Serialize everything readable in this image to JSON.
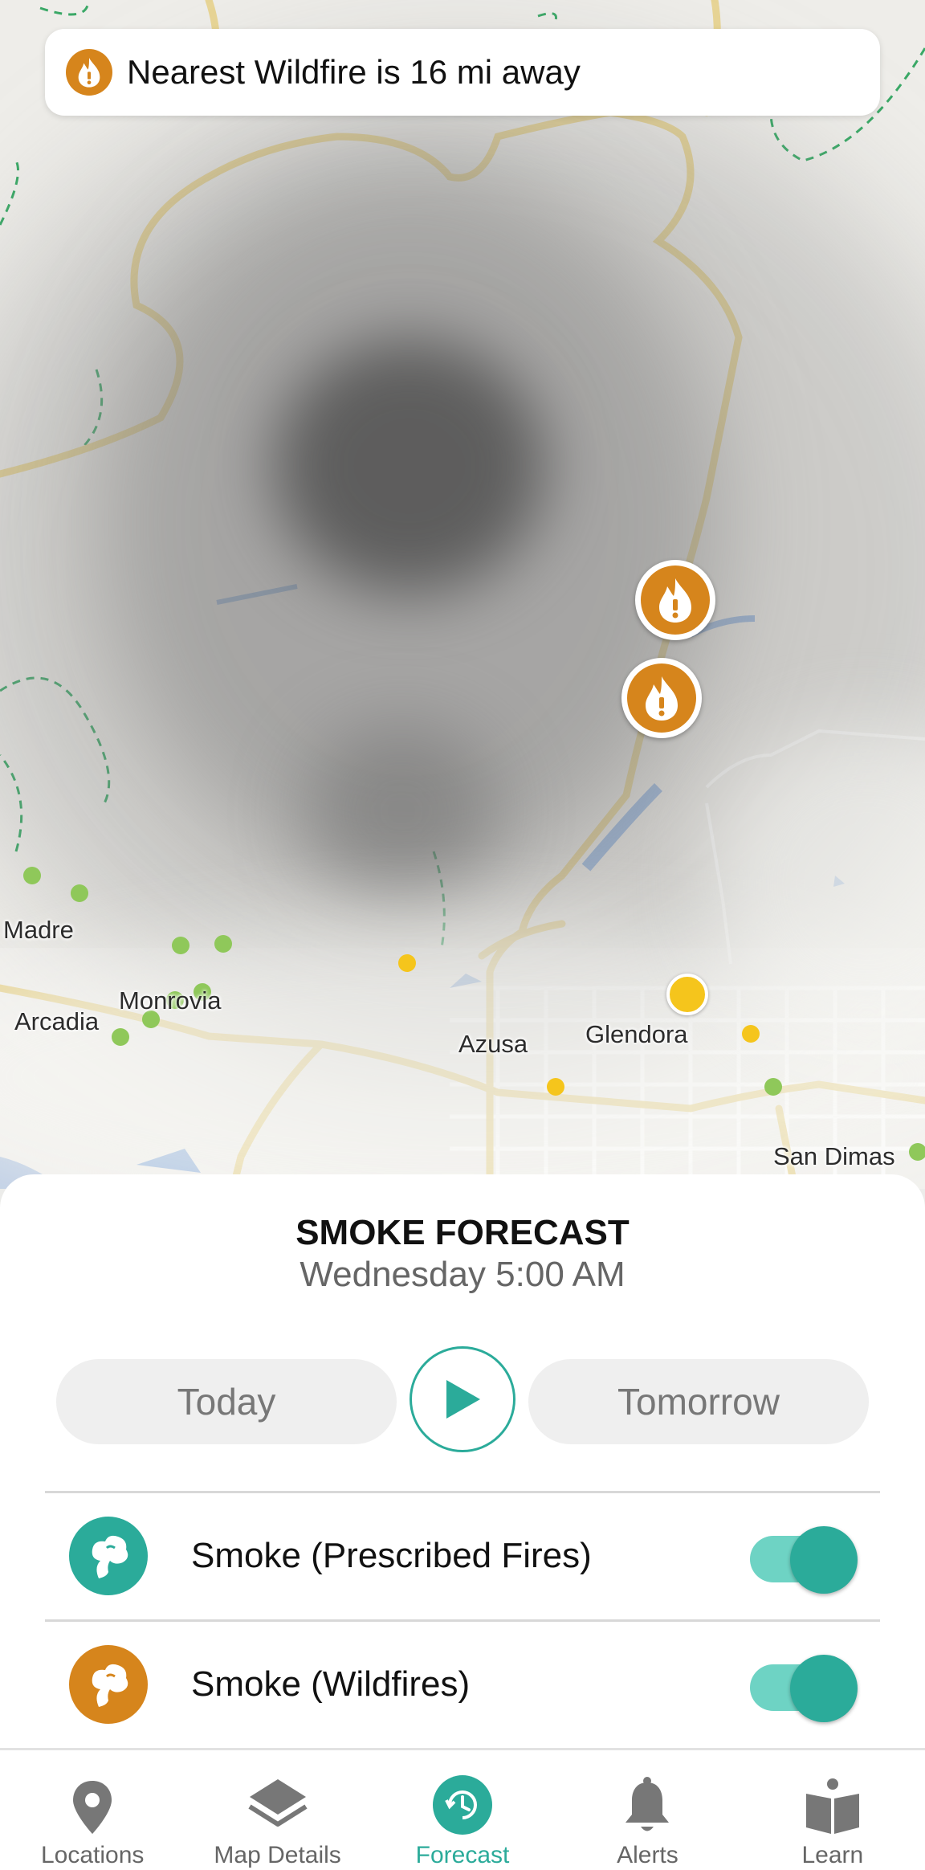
{
  "banner": {
    "icon": "fire-alert-icon",
    "text": "Nearest Wildfire is 16 mi away"
  },
  "map": {
    "cities": [
      {
        "id": "madre",
        "label": "Madre"
      },
      {
        "id": "monrovia",
        "label": "Monrovia"
      },
      {
        "id": "arcadia",
        "label": "Arcadia"
      },
      {
        "id": "azusa",
        "label": "Azusa"
      },
      {
        "id": "glendora",
        "label": "Glendora"
      },
      {
        "id": "san-dimas",
        "label": "San Dimas"
      }
    ],
    "wildfire_markers": [
      {
        "icon": "fire-alert-icon"
      },
      {
        "icon": "fire-alert-icon"
      }
    ],
    "colors": {
      "wildfire": "#d6851c",
      "monitor_good": "#8fc85a",
      "monitor_moderate": "#f5c51c"
    }
  },
  "sheet": {
    "title": "SMOKE FORECAST",
    "subtitle": "Wednesday 5:00 AM",
    "today_label": "Today",
    "tomorrow_label": "Tomorrow",
    "play_icon": "play-icon",
    "layers": [
      {
        "name": "Smoke (Prescribed Fires)",
        "icon": "smoke-cloud-icon",
        "color": "#2bab9a",
        "enabled": true
      },
      {
        "name": "Smoke (Wildfires)",
        "icon": "smoke-cloud-icon",
        "color": "#d6851c",
        "enabled": true
      }
    ]
  },
  "nav": {
    "accent": "#2bab9a",
    "active": "Forecast",
    "items": [
      {
        "label": "Locations",
        "icon": "location-pin-icon"
      },
      {
        "label": "Map Details",
        "icon": "layers-icon"
      },
      {
        "label": "Forecast",
        "icon": "forecast-clock-icon"
      },
      {
        "label": "Alerts",
        "icon": "bell-icon"
      },
      {
        "label": "Learn",
        "icon": "book-icon"
      }
    ]
  }
}
